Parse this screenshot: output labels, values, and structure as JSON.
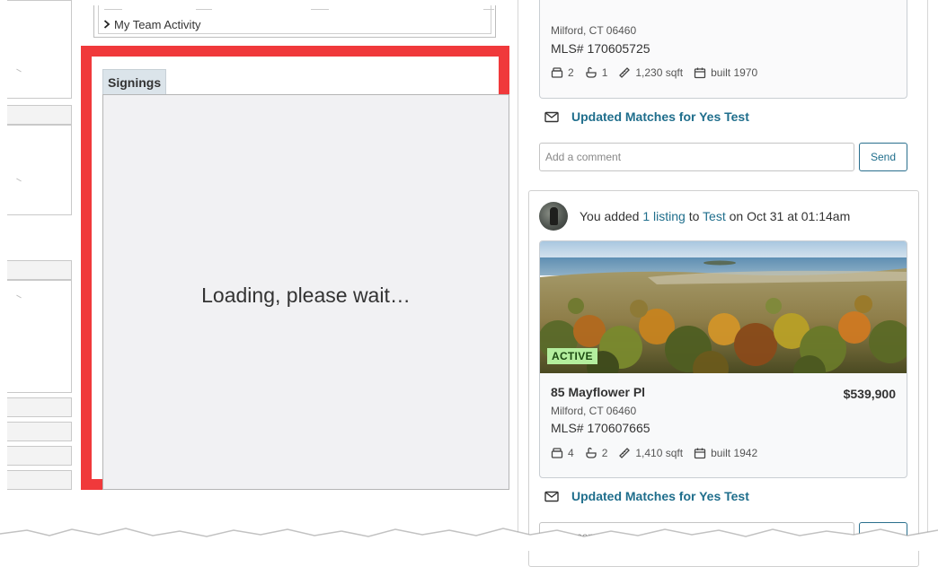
{
  "team_activity": {
    "label": "My Team Activity"
  },
  "signings": {
    "tab_label": "Signings",
    "loading_text": "Loading, please wait…"
  },
  "feed": {
    "top_listing": {
      "city": "Milford, CT 06460",
      "mls": "MLS# 170605725",
      "beds": "2",
      "baths": "1",
      "sqft": "1,230 sqft",
      "built": "built 1970"
    },
    "updated_link_1": "Updated Matches for Yes Test",
    "comment_placeholder": "Add a comment",
    "send_label": "Send",
    "activity": {
      "prefix": "You added",
      "count_link": "1 listing",
      "to": "to",
      "client_link": "Test",
      "suffix": "on Oct 31 at 01:14am"
    },
    "listing": {
      "badge": "ACTIVE",
      "street": "85 Mayflower Pl",
      "price": "$539,900",
      "city": "Milford, CT 06460",
      "mls": "MLS# 170607665",
      "beds": "4",
      "baths": "2",
      "sqft": "1,410 sqft",
      "built": "built 1942"
    },
    "updated_link_2": "Updated Matches for Yes Test",
    "comment_placeholder_2": "Add a comment"
  },
  "colors": {
    "highlight": "#f0393b",
    "link": "#1f6e8c",
    "badge_bg": "#b4ee9e"
  },
  "icons": [
    "chevron-right-icon",
    "bed-icon",
    "bath-icon",
    "ruler-icon",
    "calendar-icon",
    "mail-icon"
  ]
}
